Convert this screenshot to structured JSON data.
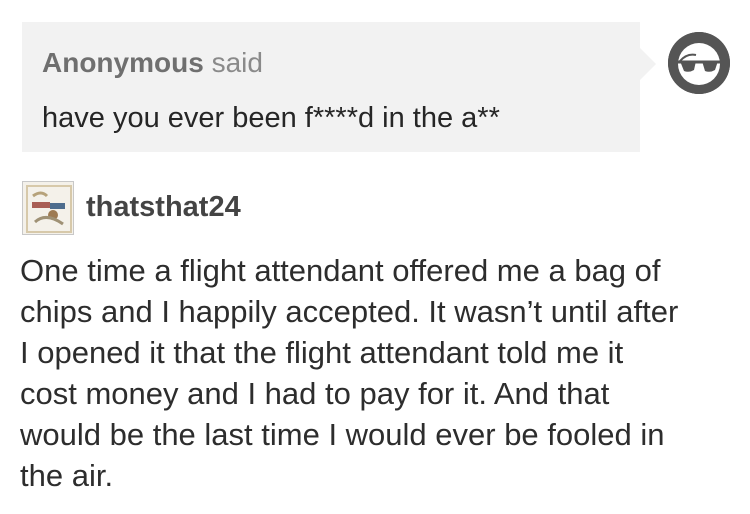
{
  "ask": {
    "asker": "Anonymous",
    "verb": "said",
    "question": "have you ever been f****d in the a**",
    "avatar_icon": "sunglasses-icon"
  },
  "reply": {
    "username": "thatsthat24",
    "avatar_icon": "user-avatar-image",
    "lines": [
      "One time a flight attendant offered me a bag of",
      "chips and I happily accepted. It wasn’t until after",
      "I opened it that the flight attendant told me it",
      "cost money and I had to pay for it. And that",
      "would be the last time I would ever be fooled in",
      "the air."
    ]
  },
  "colors": {
    "bubble_background": "#f2f2f2",
    "anon_avatar": "#555555",
    "text": "#2d2d2d"
  }
}
